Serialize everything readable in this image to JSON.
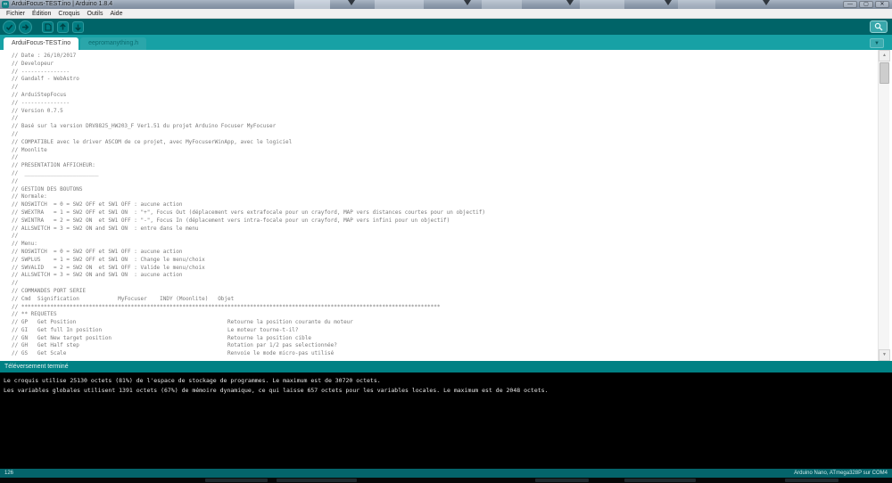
{
  "window": {
    "title": "ArduiFocus-TEST.ino | Arduino 1.8.4",
    "controls": {
      "minimize": "—",
      "maximize": "▢",
      "close": "✕"
    }
  },
  "menu": {
    "items": [
      "Fichier",
      "Édition",
      "Croquis",
      "Outils",
      "Aide"
    ]
  },
  "toolbar": {
    "icons": [
      "verify-check",
      "upload-arrow",
      "new-sketch",
      "open-sketch",
      "save-sketch",
      "serial-monitor-magnifier"
    ]
  },
  "tabs": [
    {
      "label": "ArduiFocus-TEST.ino",
      "active": true
    },
    {
      "label": "eepromanything.h",
      "active": false
    }
  ],
  "tab_menu_glyph": "▼",
  "editor": {
    "lines": [
      "// Date : 26/10/2017",
      "// Developeur",
      "// ---------------",
      "// Gandalf - WebAstro",
      "//",
      "// ArduiStepFocus",
      "// ---------------",
      "// Version 0.7.5",
      "//",
      "// Basé sur la version DRV8825_HW203_F Ver1.51 du projet Arduino Focuser MyFocuser",
      "//",
      "// COMPATIBLE avec le driver ASCOM de ce projet, avec MyFocuserWinApp, avec le logiciel",
      "// Moonlite",
      "//",
      "// PRESENTATION AFFICHEUR:",
      "//  _______________________",
      "//",
      "// GESTION DES BOUTONS",
      "// Normale:",
      "// NOSWITCH  = 0 = SW2 OFF et SW1 OFF : aucune action",
      "// SWEXTRA   = 1 = SW2 OFF et SW1 ON  : \"+\", Focus Out (déplacement vers extrafocale pour un crayford, MAP vers distances courtes pour un objectif)",
      "// SWINTRA   = 2 = SW2 ON  et SW1 OFF : \"-\", Focus In (déplacement vers intra-focale pour un crayford, MAP vers infini pour un objectif)",
      "// ALLSWITCH = 3 = SW2 ON and SW1 ON  : entre dans le menu",
      "//",
      "// Menu:",
      "// NOSWITCH  = 0 = SW2 OFF et SW1 OFF : aucune action",
      "// SWPLUS    = 1 = SW2 OFF et SW1 ON  : Change le menu/choix",
      "// SWVALID   = 2 = SW2 ON  et SW1 OFF : Valide le menu/choix",
      "// ALLSWITCH = 3 = SW2 ON and SW1 ON  : aucune action",
      "//",
      "// COMMANDES PORT SERIE",
      "// Cmd  Signification            MyFocuser    INDY (Moonlite)   Objet",
      "// **********************************************************************************************************************************",
      "// ** REQUETES",
      "// GP   Get Position                                               Retourne la position courante du moteur",
      "// GI   Get full In position                                       Le moteur tourne-t-il?",
      "// GN   Get New target position                                    Retourne la position cible",
      "// GH   Get Half step                                              Rotation par 1/2 pas selectionnée?",
      "// GS   Get Scale                                                  Renvoie le mode micro-pas utilisé"
    ]
  },
  "status": {
    "message": "Téléversement terminé"
  },
  "console": {
    "lines": [
      "Le croquis utilise 25130 octets (81%) de l'espace de stockage de programmes. Le maximum est de 30720 octets.",
      "Les variables globales utilisent 1391 octets (67%) de mémoire dynamique, ce qui laisse 657 octets pour les variables locales. Le maximum est de 2048 octets."
    ]
  },
  "line_status": {
    "line_number": "126",
    "board_info": "Arduino Nano, ATmega328P sur COM4"
  },
  "colors": {
    "toolbar_teal": "#006468",
    "tabbar_teal": "#17a1a5",
    "status_teal": "#008184",
    "linestatus_teal": "#04646b",
    "console_black": "#000000"
  }
}
